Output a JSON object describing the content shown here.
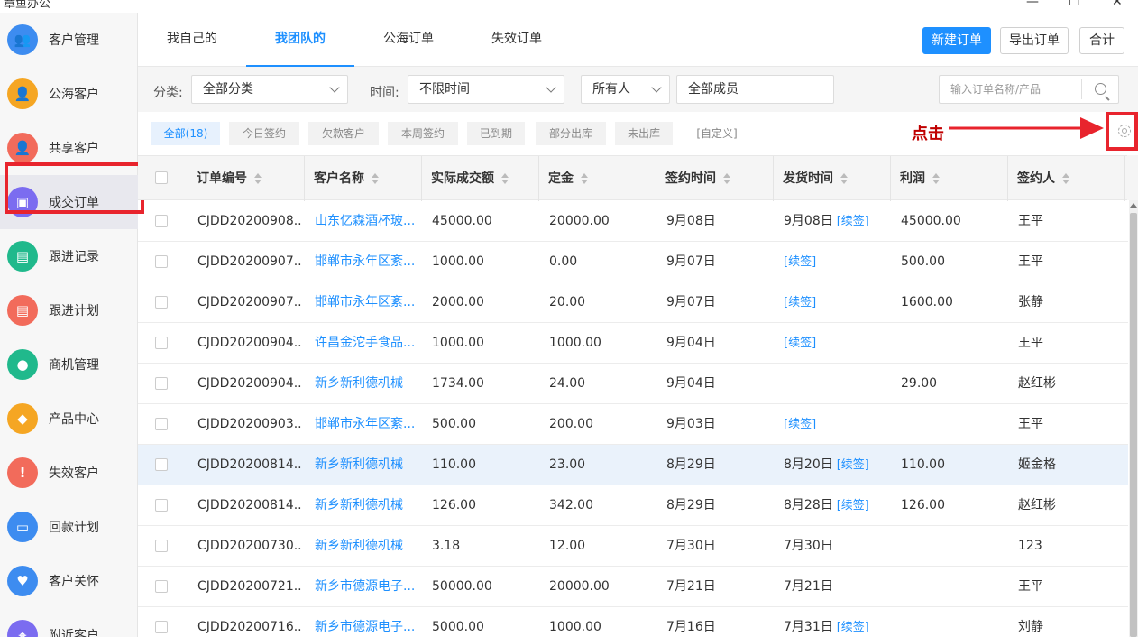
{
  "window": {
    "title": "章鱼办公",
    "controls": [
      "—",
      "☐",
      "✕"
    ]
  },
  "sidebar": {
    "items": [
      {
        "label": "客户管理",
        "icon": "customers-icon",
        "color": "#3d8cf0",
        "glyph": "👥"
      },
      {
        "label": "公海客户",
        "icon": "pool-customers-icon",
        "color": "#f5a623",
        "glyph": "👤"
      },
      {
        "label": "共享客户",
        "icon": "shared-customers-icon",
        "color": "#f26b5b",
        "glyph": "👤"
      },
      {
        "label": "成交订单",
        "icon": "order-icon",
        "color": "#7b6cf0",
        "glyph": "▣"
      },
      {
        "label": "跟进记录",
        "icon": "record-icon",
        "color": "#20b98c",
        "glyph": "▤"
      },
      {
        "label": "跟进计划",
        "icon": "plan-icon",
        "color": "#f26b5b",
        "glyph": "▤"
      },
      {
        "label": "商机管理",
        "icon": "opportunity-icon",
        "color": "#20b98c",
        "glyph": "●"
      },
      {
        "label": "产品中心",
        "icon": "product-icon",
        "color": "#f5a623",
        "glyph": "◆"
      },
      {
        "label": "失效客户",
        "icon": "invalid-customer-icon",
        "color": "#f26b5b",
        "glyph": "!"
      },
      {
        "label": "回款计划",
        "icon": "payment-plan-icon",
        "color": "#3d8cf0",
        "glyph": "▭"
      },
      {
        "label": "客户关怀",
        "icon": "care-icon",
        "color": "#3d8cf0",
        "glyph": "♥"
      },
      {
        "label": "附近客户",
        "icon": "nearby-icon",
        "color": "#7b6cf0",
        "glyph": "⌖"
      }
    ]
  },
  "tabs": [
    {
      "label": "我自己的",
      "active": false
    },
    {
      "label": "我团队的",
      "active": true
    },
    {
      "label": "公海订单",
      "active": false
    },
    {
      "label": "失效订单",
      "active": false
    }
  ],
  "toolbar": {
    "new_label": "新建订单",
    "export_label": "导出订单",
    "sum_label": "合计"
  },
  "filters": {
    "category_label": "分类:",
    "category_value": "全部分类",
    "time_label": "时间:",
    "time_value": "不限时间",
    "owner_value": "所有人",
    "member_value": "全部成员",
    "search_placeholder": "输入订单名称/产品"
  },
  "chips": [
    {
      "label": "全部(18)",
      "active": true
    },
    {
      "label": "今日签约"
    },
    {
      "label": "欠款客户"
    },
    {
      "label": "本周签约"
    },
    {
      "label": "已到期"
    },
    {
      "label": "部分出库"
    },
    {
      "label": "未出库"
    },
    {
      "label": "[自定义]",
      "plain": true
    }
  ],
  "annotation": {
    "text": "点击"
  },
  "table": {
    "columns": [
      "订单编号",
      "客户名称",
      "实际成交额",
      "定金",
      "签约时间",
      "发货时间",
      "利润",
      "签约人"
    ],
    "renew_label": "[续签]",
    "rows": [
      {
        "id": "CJDD20200908...",
        "customer": "山东亿森酒杯玻...",
        "amount": "45000.00",
        "deposit": "20000.00",
        "sign": "9月08日",
        "ship": "9月08日",
        "renew": true,
        "profit": "45000.00",
        "signer": "王平"
      },
      {
        "id": "CJDD20200907...",
        "customer": "邯郸市永年区紊...",
        "amount": "1000.00",
        "deposit": "0.00",
        "sign": "9月07日",
        "ship": "",
        "renew": true,
        "profit": "500.00",
        "signer": "王平"
      },
      {
        "id": "CJDD20200907...",
        "customer": "邯郸市永年区紊...",
        "amount": "2000.00",
        "deposit": "20.00",
        "sign": "9月07日",
        "ship": "",
        "renew": true,
        "profit": "1600.00",
        "signer": "张静"
      },
      {
        "id": "CJDD20200904...",
        "customer": "许昌金沱手食品...",
        "amount": "1000.00",
        "deposit": "1000.00",
        "sign": "9月04日",
        "ship": "",
        "renew": true,
        "profit": "",
        "signer": "王平"
      },
      {
        "id": "CJDD20200904...",
        "customer": "新乡新利德机械",
        "amount": "1734.00",
        "deposit": "24.00",
        "sign": "9月04日",
        "ship": "",
        "renew": false,
        "profit": "29.00",
        "signer": "赵红彬"
      },
      {
        "id": "CJDD20200903...",
        "customer": "邯郸市永年区紊...",
        "amount": "500.00",
        "deposit": "200.00",
        "sign": "9月03日",
        "ship": "",
        "renew": true,
        "profit": "",
        "signer": "王平"
      },
      {
        "id": "CJDD20200814...",
        "customer": "新乡新利德机械",
        "amount": "110.00",
        "deposit": "23.00",
        "sign": "8月29日",
        "ship": "8月20日",
        "renew": true,
        "profit": "110.00",
        "signer": "姬金格"
      },
      {
        "id": "CJDD20200814...",
        "customer": "新乡新利德机械",
        "amount": "126.00",
        "deposit": "342.00",
        "sign": "8月29日",
        "ship": "8月28日",
        "renew": true,
        "profit": "126.00",
        "signer": "赵红彬"
      },
      {
        "id": "CJDD20200730...",
        "customer": "新乡新利德机械",
        "amount": "3.18",
        "deposit": "12.00",
        "sign": "7月30日",
        "ship": "7月30日",
        "renew": false,
        "profit": "",
        "signer": "123"
      },
      {
        "id": "CJDD20200721...",
        "customer": "新乡市德源电子...",
        "amount": "50000.00",
        "deposit": "20000.00",
        "sign": "7月21日",
        "ship": "7月21日",
        "renew": false,
        "profit": "",
        "signer": "王平"
      },
      {
        "id": "CJDD20200716...",
        "customer": "新乡市德源电子...",
        "amount": "5000.00",
        "deposit": "1000.00",
        "sign": "7月16日",
        "ship": "7月31日",
        "renew": true,
        "profit": "",
        "signer": "刘静"
      }
    ]
  },
  "colors": {
    "accent": "#1e90ff",
    "highlight_box": "#e8242d",
    "annotation": "#c00000"
  }
}
